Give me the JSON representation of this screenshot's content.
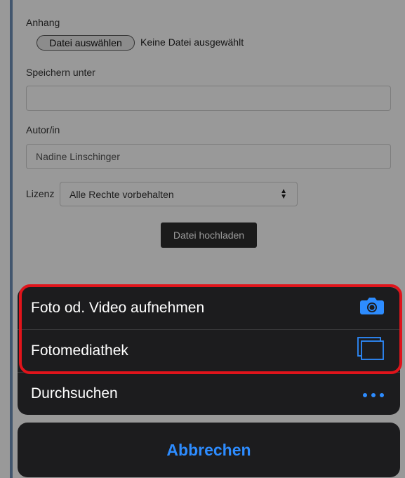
{
  "form": {
    "attachment_label": "Anhang",
    "choose_file_button": "Datei auswählen",
    "file_status": "Keine Datei ausgewählt",
    "save_as_label": "Speichern unter",
    "save_as_value": "",
    "author_label": "Autor/in",
    "author_value": "Nadine Linschinger",
    "license_label": "Lizenz",
    "license_selected": "Alle Rechte vorbehalten",
    "upload_button": "Datei hochladen"
  },
  "action_sheet": {
    "items": [
      {
        "label": "Foto od. Video aufnehmen",
        "icon": "camera-icon"
      },
      {
        "label": "Fotomediathek",
        "icon": "photo-library-icon"
      },
      {
        "label": "Durchsuchen",
        "icon": "more-dots-icon"
      }
    ],
    "cancel_label": "Abbrechen"
  },
  "colors": {
    "sheet_background": "#1c1c1e",
    "accent_blue": "#2d8cff",
    "highlight_red": "#e0141b"
  }
}
